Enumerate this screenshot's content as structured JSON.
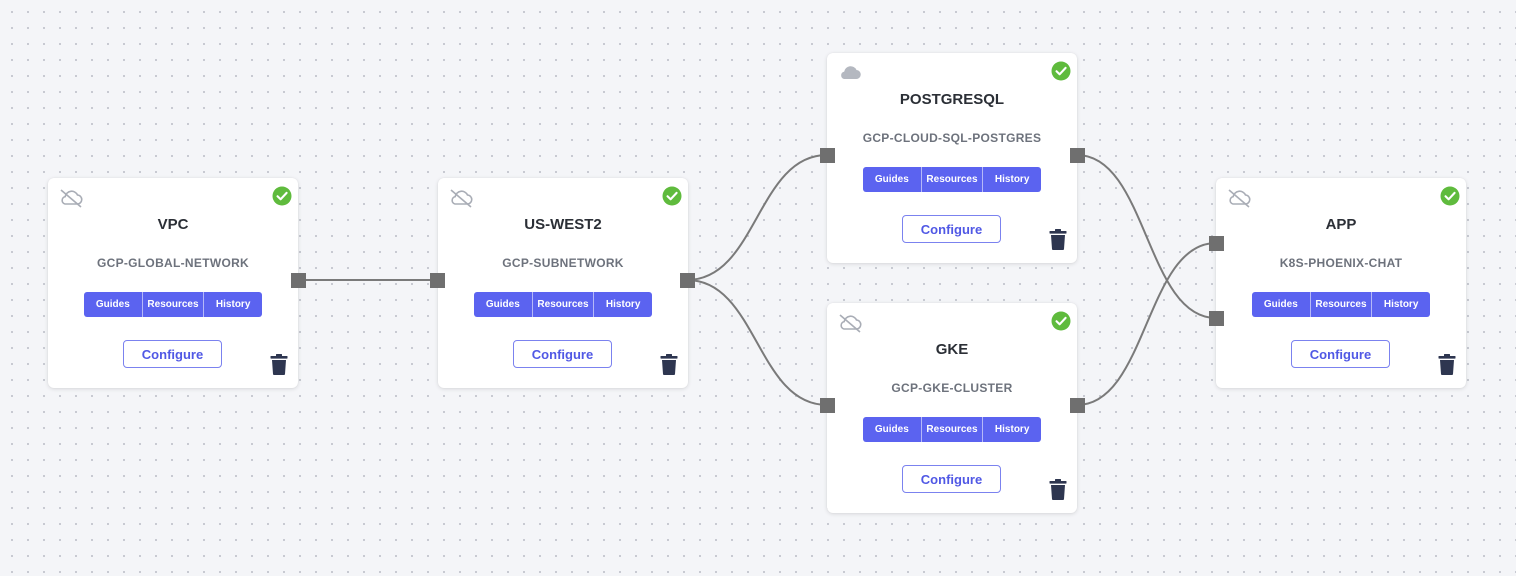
{
  "canvas": {
    "wire_color": "#7a7a7a",
    "port_color": "#6f6f6f",
    "accent": "#5b63f0",
    "success": "#5fbb3d",
    "trash_color": "#2e3650"
  },
  "nodes": {
    "vpc": {
      "title": "VPC",
      "subtitle": "GCP-GLOBAL-NETWORK",
      "cloud_icon": "cloud-offline-icon",
      "status_icon": "check-circle-icon",
      "tabs": [
        "Guides",
        "Resources",
        "History"
      ],
      "configure_label": "Configure"
    },
    "uswest2": {
      "title": "US-WEST2",
      "subtitle": "GCP-SUBNETWORK",
      "cloud_icon": "cloud-offline-icon",
      "status_icon": "check-circle-icon",
      "tabs": [
        "Guides",
        "Resources",
        "History"
      ],
      "configure_label": "Configure"
    },
    "postgres": {
      "title": "POSTGRESQL",
      "subtitle": "GCP-CLOUD-SQL-POSTGRES",
      "cloud_icon": "cloud-icon",
      "status_icon": "check-circle-icon",
      "tabs": [
        "Guides",
        "Resources",
        "History"
      ],
      "configure_label": "Configure"
    },
    "gke": {
      "title": "GKE",
      "subtitle": "GCP-GKE-CLUSTER",
      "cloud_icon": "cloud-offline-icon",
      "status_icon": "check-circle-icon",
      "tabs": [
        "Guides",
        "Resources",
        "History"
      ],
      "configure_label": "Configure"
    },
    "app": {
      "title": "APP",
      "subtitle": "K8S-PHOENIX-CHAT",
      "cloud_icon": "cloud-offline-icon",
      "status_icon": "check-circle-icon",
      "tabs": [
        "Guides",
        "Resources",
        "History"
      ],
      "configure_label": "Configure"
    }
  },
  "connections": [
    {
      "from": "vpc",
      "to": "uswest2"
    },
    {
      "from": "uswest2",
      "to": "postgres"
    },
    {
      "from": "uswest2",
      "to": "gke"
    },
    {
      "from": "postgres",
      "to": "app"
    },
    {
      "from": "gke",
      "to": "app"
    }
  ]
}
